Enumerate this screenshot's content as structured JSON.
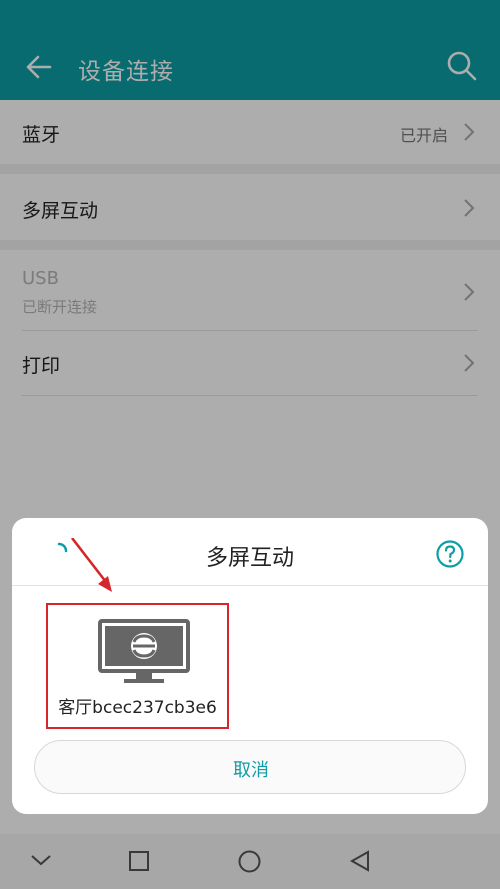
{
  "header": {
    "title": "设备连接",
    "back_icon": "arrow-left-icon",
    "search_icon": "search-icon"
  },
  "settings": {
    "bluetooth": {
      "label": "蓝牙",
      "status": "已开启"
    },
    "multiscreen": {
      "label": "多屏互动"
    },
    "usb": {
      "label": "USB",
      "status": "已断开连接"
    },
    "print": {
      "label": "打印"
    }
  },
  "dialog": {
    "title": "多屏互动",
    "device_name": "客厅bcec237cb3e6",
    "cancel_label": "取消",
    "help_icon": "question-circle-icon",
    "spinner_icon": "loading-spinner-icon",
    "device_icon": "tv-icon"
  },
  "colors": {
    "accent": "#0d9ea6",
    "highlight": "#d7262b"
  }
}
